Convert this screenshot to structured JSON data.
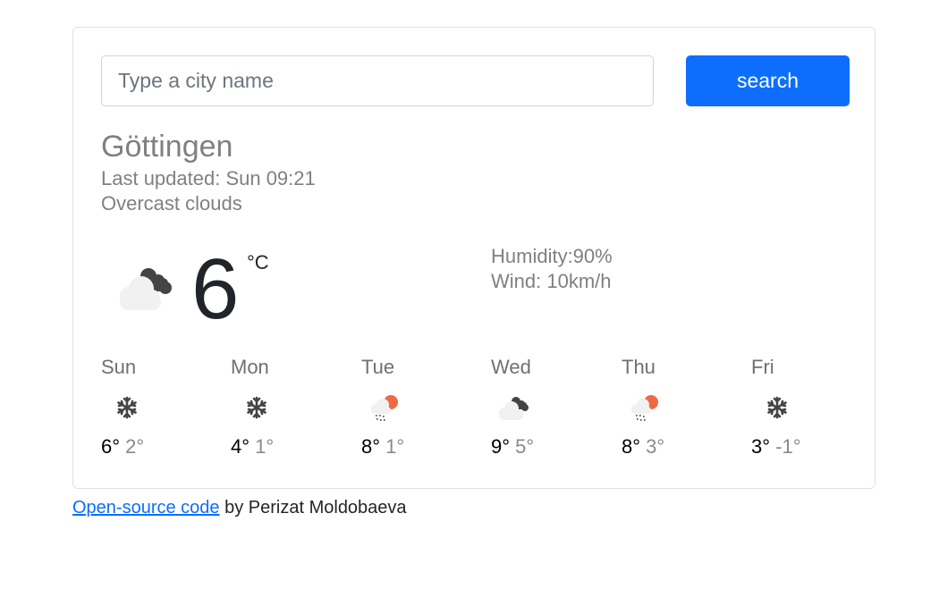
{
  "search": {
    "placeholder": "Type a city name",
    "value": "",
    "button_label": "search",
    "button_color": "#0d6efd"
  },
  "current": {
    "city": "Göttingen",
    "last_updated": "Last updated: Sun 09:21",
    "description": "Overcast clouds",
    "icon": "overcast-clouds-icon",
    "temperature": "6",
    "unit": "°C",
    "humidity": "Humidity:90%",
    "wind": "Wind: 10km/h"
  },
  "forecast": [
    {
      "day": "Sun",
      "icon": "snow-icon",
      "max": "6°",
      "min": "2°"
    },
    {
      "day": "Mon",
      "icon": "snow-icon",
      "max": "4°",
      "min": "1°"
    },
    {
      "day": "Tue",
      "icon": "rain-sun-icon",
      "max": "8°",
      "min": "1°"
    },
    {
      "day": "Wed",
      "icon": "overcast-clouds-icon",
      "max": "9°",
      "min": "5°"
    },
    {
      "day": "Thu",
      "icon": "rain-sun-icon",
      "max": "8°",
      "min": "3°"
    },
    {
      "day": "Fri",
      "icon": "snow-icon",
      "max": "3°",
      "min": "-1°"
    }
  ],
  "footer": {
    "link_text": "Open-source code",
    "suffix": " by Perizat Moldobaeva"
  }
}
